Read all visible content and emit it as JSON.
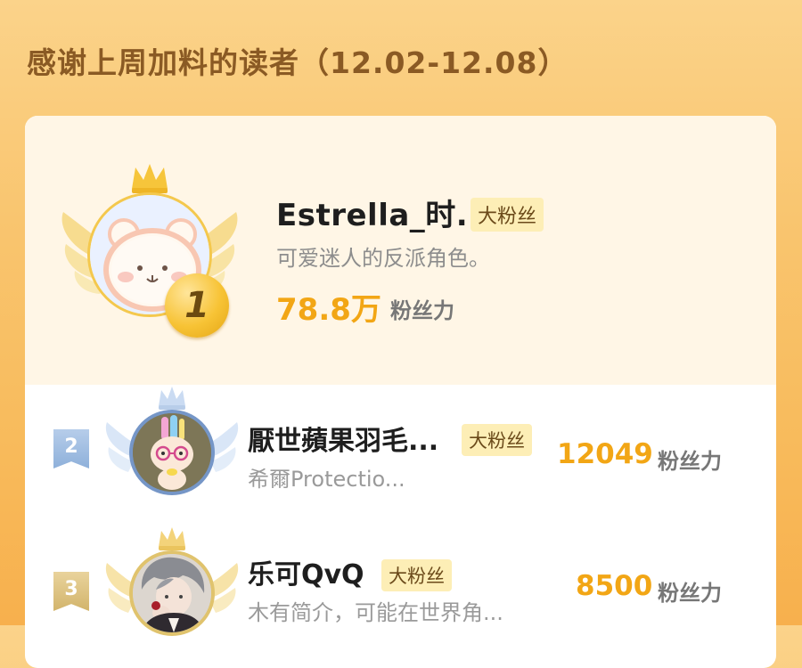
{
  "header": {
    "title": "感谢上周加料的读者（12.02-12.08）"
  },
  "leaderboard": {
    "top": {
      "rank": "1",
      "name": "Estrella_时...",
      "tag": "大粉丝",
      "description": "可爱迷人的反派角色。",
      "value": "78.8万",
      "unit": "粉丝力"
    },
    "rows": [
      {
        "rank": "2",
        "name": "厭世蘋果羽毛...",
        "tag": "大粉丝",
        "description": "希爾Protectio...",
        "value": "12049",
        "unit": "粉丝力"
      },
      {
        "rank": "3",
        "name": "乐可QvQ",
        "tag": "大粉丝",
        "description": "木有简介，可能在世界角...",
        "value": "8500",
        "unit": "粉丝力"
      }
    ]
  },
  "colors": {
    "background": "#f9c56f",
    "title": "#8a5a24",
    "value": "#f2a615",
    "tag_bg": "#fdeeb6",
    "rank2_flag": "#9bb8e0",
    "rank3_flag": "#dcc07c",
    "gold": "#f4c84d"
  },
  "icons": {
    "top_badge": "gold-winged-crown-badge-icon",
    "rank2_badge": "silver-winged-crown-badge-icon",
    "rank3_badge": "gold-winged-crown-badge-icon",
    "top_avatar": "white-bear-avatar",
    "rank2_avatar": "rabbit-with-glasses-avatar",
    "rank3_avatar": "grey-haired-character-avatar"
  }
}
